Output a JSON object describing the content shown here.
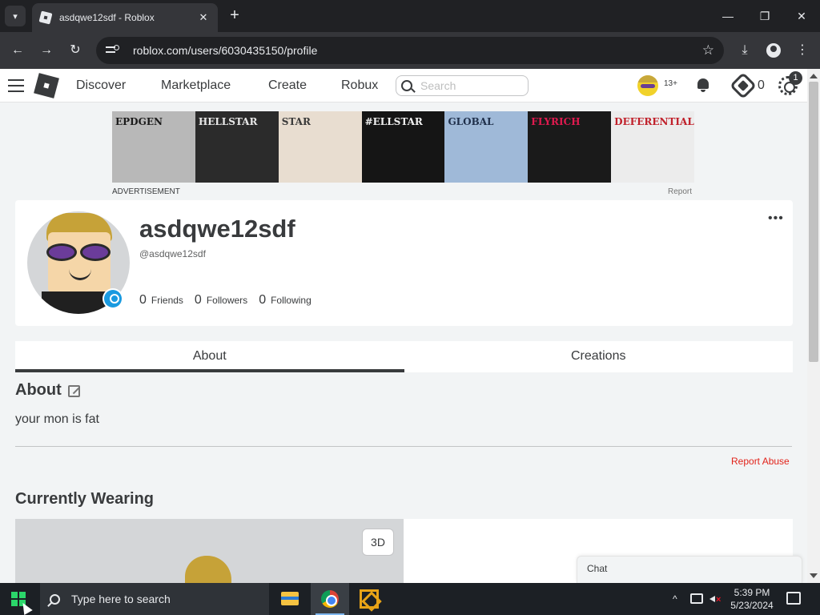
{
  "browser": {
    "tab_title": "asdqwe12sdf - Roblox",
    "url": "roblox.com/users/6030435150/profile"
  },
  "nav": {
    "links": [
      "Discover",
      "Marketplace",
      "Create",
      "Robux"
    ],
    "search_placeholder": "Search",
    "age_badge": "13+",
    "robux_count": "0",
    "settings_badge": "1"
  },
  "ad": {
    "label": "ADVERTISEMENT",
    "report": "Report",
    "panels": [
      {
        "text": "EPDGEN",
        "bg": "#b8b8b8",
        "fg": "#1a1a1a"
      },
      {
        "text": "HELLSTAR",
        "bg": "#2b2b2b",
        "fg": "#e8e8e8"
      },
      {
        "text": "STAR",
        "bg": "#e8ddd0",
        "fg": "#3a3a3a"
      },
      {
        "text": "#ELLSTAR",
        "bg": "#151515",
        "fg": "#f0f0f0"
      },
      {
        "text": "GLOBAL",
        "bg": "#9fb9d8",
        "fg": "#1f2f4a"
      },
      {
        "text": "FLYRICH",
        "bg": "#1a1a1a",
        "fg": "#e01a4f"
      },
      {
        "text": "DEFERENTIAL",
        "bg": "#ececec",
        "fg": "#c0202a"
      }
    ]
  },
  "profile": {
    "display_name": "asdqwe12sdf",
    "username": "@asdqwe12sdf",
    "friends_count": "0",
    "friends_label": "Friends",
    "followers_count": "0",
    "followers_label": "Followers",
    "following_count": "0",
    "following_label": "Following",
    "more_label": "•••"
  },
  "tabs": [
    "About",
    "Creations"
  ],
  "about": {
    "title": "About",
    "bio": "your mon is fat",
    "report_abuse": "Report Abuse"
  },
  "wearing": {
    "title": "Currently Wearing",
    "btn_3d": "3D"
  },
  "chat": {
    "label": "Chat"
  },
  "taskbar": {
    "search_text": "Type here to search",
    "time": "5:39 PM",
    "date": "5/23/2024"
  },
  "colors": {
    "accent_text": "#393b3d",
    "report_red": "#e2231a",
    "online_blue": "#1a9ae0"
  }
}
